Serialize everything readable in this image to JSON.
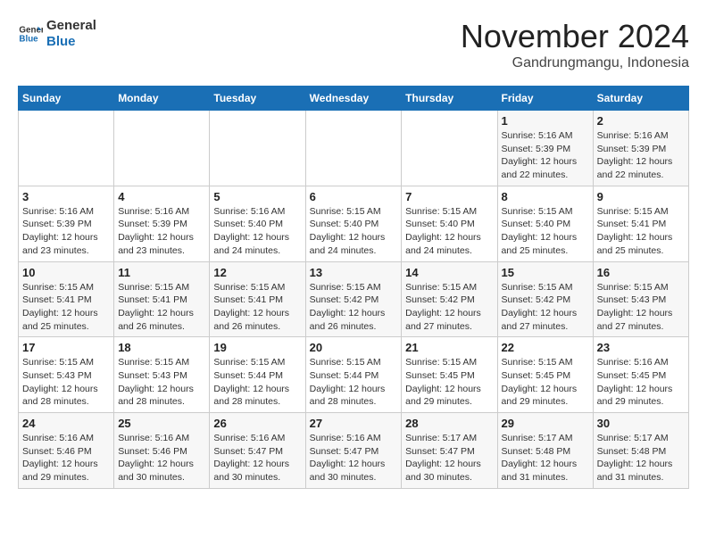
{
  "header": {
    "logo_line1": "General",
    "logo_line2": "Blue",
    "title": "November 2024",
    "subtitle": "Gandrungmangu, Indonesia"
  },
  "weekdays": [
    "Sunday",
    "Monday",
    "Tuesday",
    "Wednesday",
    "Thursday",
    "Friday",
    "Saturday"
  ],
  "weeks": [
    [
      {
        "day": "",
        "info": ""
      },
      {
        "day": "",
        "info": ""
      },
      {
        "day": "",
        "info": ""
      },
      {
        "day": "",
        "info": ""
      },
      {
        "day": "",
        "info": ""
      },
      {
        "day": "1",
        "info": "Sunrise: 5:16 AM\nSunset: 5:39 PM\nDaylight: 12 hours and 22 minutes."
      },
      {
        "day": "2",
        "info": "Sunrise: 5:16 AM\nSunset: 5:39 PM\nDaylight: 12 hours and 22 minutes."
      }
    ],
    [
      {
        "day": "3",
        "info": "Sunrise: 5:16 AM\nSunset: 5:39 PM\nDaylight: 12 hours and 23 minutes."
      },
      {
        "day": "4",
        "info": "Sunrise: 5:16 AM\nSunset: 5:39 PM\nDaylight: 12 hours and 23 minutes."
      },
      {
        "day": "5",
        "info": "Sunrise: 5:16 AM\nSunset: 5:40 PM\nDaylight: 12 hours and 24 minutes."
      },
      {
        "day": "6",
        "info": "Sunrise: 5:15 AM\nSunset: 5:40 PM\nDaylight: 12 hours and 24 minutes."
      },
      {
        "day": "7",
        "info": "Sunrise: 5:15 AM\nSunset: 5:40 PM\nDaylight: 12 hours and 24 minutes."
      },
      {
        "day": "8",
        "info": "Sunrise: 5:15 AM\nSunset: 5:40 PM\nDaylight: 12 hours and 25 minutes."
      },
      {
        "day": "9",
        "info": "Sunrise: 5:15 AM\nSunset: 5:41 PM\nDaylight: 12 hours and 25 minutes."
      }
    ],
    [
      {
        "day": "10",
        "info": "Sunrise: 5:15 AM\nSunset: 5:41 PM\nDaylight: 12 hours and 25 minutes."
      },
      {
        "day": "11",
        "info": "Sunrise: 5:15 AM\nSunset: 5:41 PM\nDaylight: 12 hours and 26 minutes."
      },
      {
        "day": "12",
        "info": "Sunrise: 5:15 AM\nSunset: 5:41 PM\nDaylight: 12 hours and 26 minutes."
      },
      {
        "day": "13",
        "info": "Sunrise: 5:15 AM\nSunset: 5:42 PM\nDaylight: 12 hours and 26 minutes."
      },
      {
        "day": "14",
        "info": "Sunrise: 5:15 AM\nSunset: 5:42 PM\nDaylight: 12 hours and 27 minutes."
      },
      {
        "day": "15",
        "info": "Sunrise: 5:15 AM\nSunset: 5:42 PM\nDaylight: 12 hours and 27 minutes."
      },
      {
        "day": "16",
        "info": "Sunrise: 5:15 AM\nSunset: 5:43 PM\nDaylight: 12 hours and 27 minutes."
      }
    ],
    [
      {
        "day": "17",
        "info": "Sunrise: 5:15 AM\nSunset: 5:43 PM\nDaylight: 12 hours and 28 minutes."
      },
      {
        "day": "18",
        "info": "Sunrise: 5:15 AM\nSunset: 5:43 PM\nDaylight: 12 hours and 28 minutes."
      },
      {
        "day": "19",
        "info": "Sunrise: 5:15 AM\nSunset: 5:44 PM\nDaylight: 12 hours and 28 minutes."
      },
      {
        "day": "20",
        "info": "Sunrise: 5:15 AM\nSunset: 5:44 PM\nDaylight: 12 hours and 28 minutes."
      },
      {
        "day": "21",
        "info": "Sunrise: 5:15 AM\nSunset: 5:45 PM\nDaylight: 12 hours and 29 minutes."
      },
      {
        "day": "22",
        "info": "Sunrise: 5:15 AM\nSunset: 5:45 PM\nDaylight: 12 hours and 29 minutes."
      },
      {
        "day": "23",
        "info": "Sunrise: 5:16 AM\nSunset: 5:45 PM\nDaylight: 12 hours and 29 minutes."
      }
    ],
    [
      {
        "day": "24",
        "info": "Sunrise: 5:16 AM\nSunset: 5:46 PM\nDaylight: 12 hours and 29 minutes."
      },
      {
        "day": "25",
        "info": "Sunrise: 5:16 AM\nSunset: 5:46 PM\nDaylight: 12 hours and 30 minutes."
      },
      {
        "day": "26",
        "info": "Sunrise: 5:16 AM\nSunset: 5:47 PM\nDaylight: 12 hours and 30 minutes."
      },
      {
        "day": "27",
        "info": "Sunrise: 5:16 AM\nSunset: 5:47 PM\nDaylight: 12 hours and 30 minutes."
      },
      {
        "day": "28",
        "info": "Sunrise: 5:17 AM\nSunset: 5:47 PM\nDaylight: 12 hours and 30 minutes."
      },
      {
        "day": "29",
        "info": "Sunrise: 5:17 AM\nSunset: 5:48 PM\nDaylight: 12 hours and 31 minutes."
      },
      {
        "day": "30",
        "info": "Sunrise: 5:17 AM\nSunset: 5:48 PM\nDaylight: 12 hours and 31 minutes."
      }
    ]
  ]
}
